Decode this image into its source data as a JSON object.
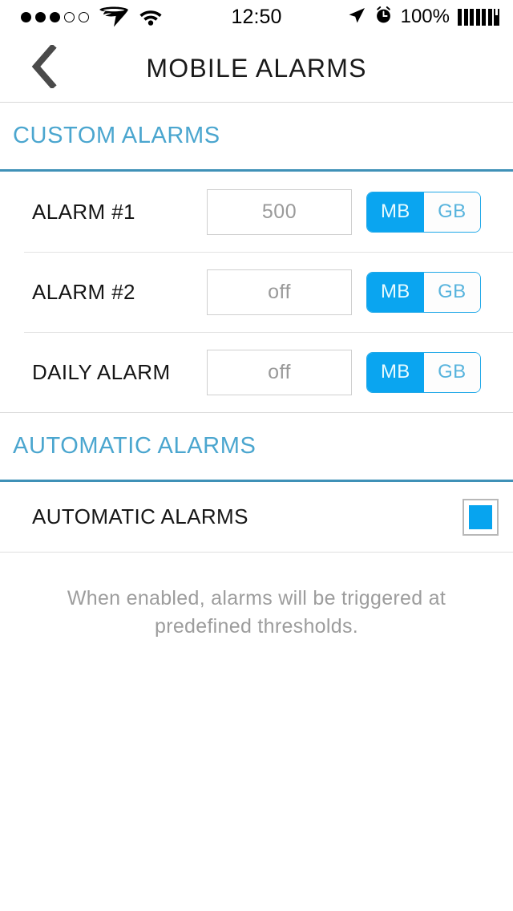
{
  "status_bar": {
    "signal_dots_total": 5,
    "signal_dots_filled": 3,
    "carrier_icon": "superman-logo-icon",
    "wifi_icon": "wifi-icon",
    "time": "12:50",
    "location_icon": "location-arrow-icon",
    "alarm_icon": "alarm-clock-icon",
    "battery_percent": "100%",
    "battery_icon": "battery-charging-icon"
  },
  "nav": {
    "back_icon": "chevron-left-icon",
    "title": "MOBILE ALARMS"
  },
  "sections": {
    "custom": {
      "header": "CUSTOM ALARMS",
      "rows": [
        {
          "label": "ALARM #1",
          "value": "500",
          "unit_options": [
            "MB",
            "GB"
          ],
          "unit_selected": "MB"
        },
        {
          "label": "ALARM #2",
          "value": "off",
          "unit_options": [
            "MB",
            "GB"
          ],
          "unit_selected": "MB"
        },
        {
          "label": "DAILY ALARM",
          "value": "off",
          "unit_options": [
            "MB",
            "GB"
          ],
          "unit_selected": "MB"
        }
      ]
    },
    "automatic": {
      "header": "AUTOMATIC ALARMS",
      "toggle_label": "AUTOMATIC ALARMS",
      "toggle_checked": true,
      "note": "When enabled, alarms will be triggered at predefined thresholds."
    }
  },
  "colors": {
    "accent_blue": "#0aa5f0",
    "section_header_blue": "#4ba6cf",
    "section_rule_blue": "#3f91b7",
    "muted_text": "#9d9d9d"
  }
}
